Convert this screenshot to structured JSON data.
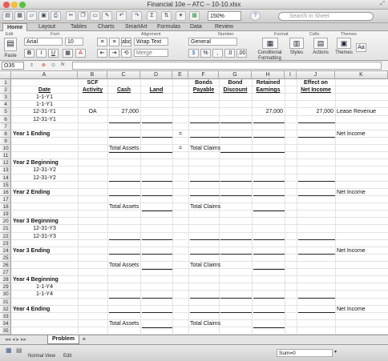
{
  "window": {
    "title": "Financial 10e – ATC – 10-10.xlsx"
  },
  "toolbar": {
    "zoom": "150%",
    "search_placeholder": "Search in Sheet"
  },
  "ribbon": {
    "tabs": [
      "Home",
      "Layout",
      "Tables",
      "Charts",
      "SmartArt",
      "Formulas",
      "Data",
      "Review"
    ],
    "groups": [
      "Edit",
      "Font",
      "Alignment",
      "Number",
      "Format",
      "Cells",
      "Themes"
    ],
    "font_name": "Arial",
    "font_size": "10",
    "number_format": "General",
    "wrap_text": "Wrap Text",
    "merge": "Merge",
    "paste": "Paste",
    "conditional_formatting": "Conditional Formatting",
    "styles": "Styles",
    "actions": "Actions",
    "themes": "Themes",
    "clear": "abc",
    "theme_font": "Aa",
    "bold": "B",
    "italic": "I",
    "underline": "U",
    "font_color": "A",
    "percent": "%",
    "comma": ","
  },
  "formula_bar": {
    "name_box": "O35",
    "fx": "fx",
    "value": ""
  },
  "columns": [
    "A",
    "B",
    "C",
    "D",
    "E",
    "F",
    "G",
    "H",
    "I",
    "J",
    "K"
  ],
  "rows": [
    "1",
    "2",
    "3",
    "4",
    "5",
    "6",
    "7",
    "8",
    "9",
    "10",
    "11",
    "12",
    "13",
    "14",
    "15",
    "16",
    "17",
    "18",
    "19",
    "20",
    "21",
    "22",
    "23",
    "24",
    "25",
    "26",
    "27",
    "28",
    "29",
    "30",
    "31",
    "32",
    "33",
    "34",
    "35"
  ],
  "cells": {
    "b1": "SCF",
    "f1": "Bonds",
    "g1": "Bond",
    "h1": "Retained",
    "j1": "Effect on",
    "a2": "Date",
    "b2": "Activity",
    "c2": "Cash",
    "d2": "Land",
    "f2": "Payable",
    "g2": "Discount",
    "h2": "Earnings",
    "j2": "Net Income",
    "a3": "1-1-Y1",
    "a4": "1-1-Y1",
    "a5": "12-31-Y1",
    "b5": "OA",
    "c5": "27,000",
    "h5": "27,000",
    "j5": "27,000",
    "k5": "Lease Revenue",
    "a6": "12-31-Y1",
    "a8": "Year 1 Ending",
    "e8": "=",
    "k8": "Net Income",
    "c10": "Total Assets",
    "e10": "=",
    "f10": "Total Claims",
    "a12": "Year 2 Beginning",
    "a13": "12-31-Y2",
    "a14": "12-31-Y2",
    "a16": "Year 2 Ending",
    "k16": "Net Income",
    "c18": "Total Assets",
    "f18": "Total Claims",
    "a20": "Year 3 Beginning",
    "a21": "12-31-Y3",
    "a22": "12-31-Y3",
    "a24": "Year 3 Ending",
    "k24": "Net Income",
    "c26": "Total Assets",
    "f26": "Total Claims",
    "a28": "Year 4 Beginning",
    "a29": "1-1-Y4",
    "a30": "1-1-Y4",
    "a32": "Year 4 Ending",
    "k32": "Net Income",
    "c34": "Total Assets",
    "f34": "Total Claims"
  },
  "sheet_tabs": {
    "active": "Problem",
    "add": "+"
  },
  "statusbar": {
    "view": "Normal View",
    "mode": "Edit",
    "sum": "Sum=0"
  }
}
